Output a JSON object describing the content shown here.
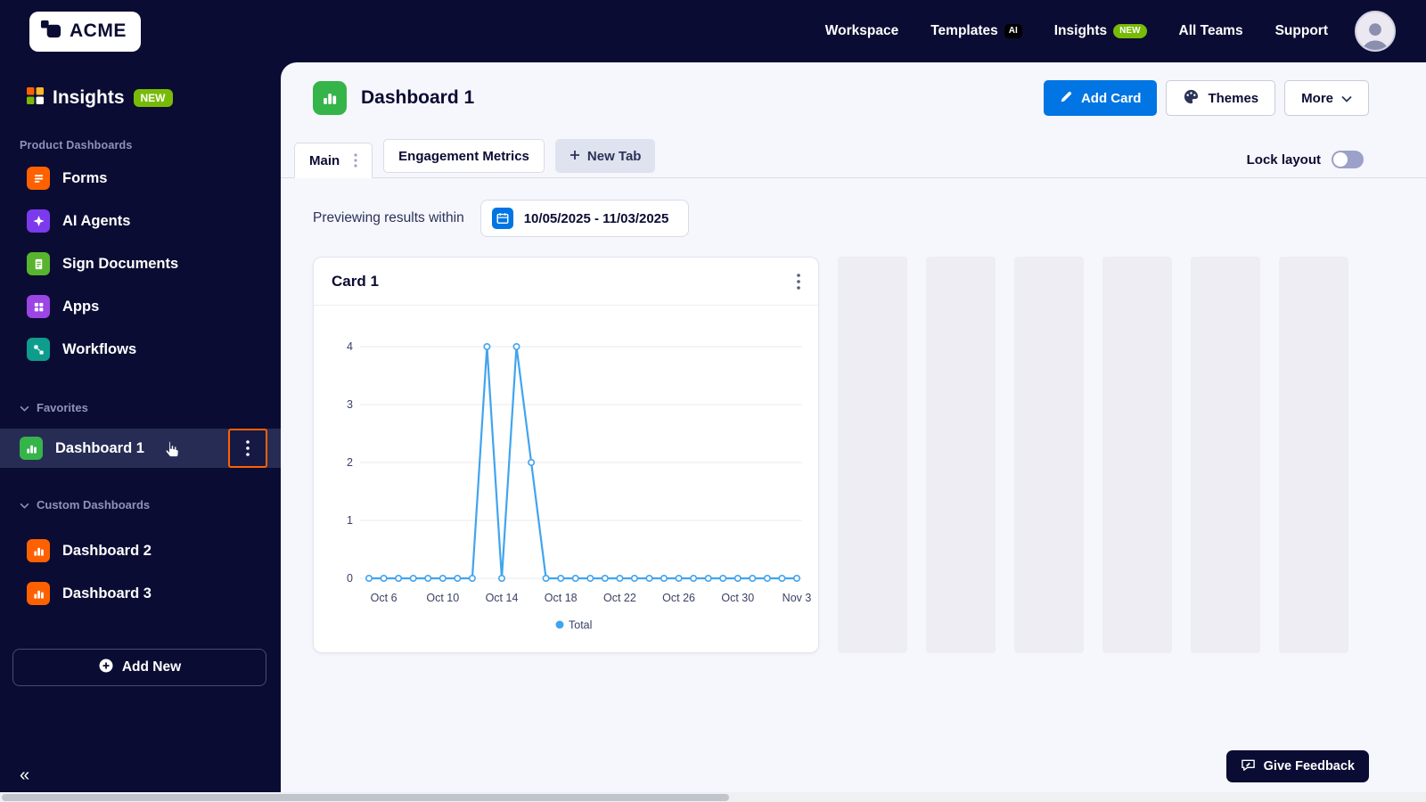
{
  "topbar": {
    "logo_text": "ACME",
    "nav": [
      {
        "label": "Workspace"
      },
      {
        "label": "Templates",
        "badge": "AI"
      },
      {
        "label": "Insights",
        "badge": "NEW"
      },
      {
        "label": "All Teams"
      },
      {
        "label": "Support"
      }
    ]
  },
  "sidebar": {
    "app_title": "Insights",
    "app_badge": "NEW",
    "product_section_label": "Product Dashboards",
    "product_items": [
      {
        "label": "Forms",
        "color": "#ff6100"
      },
      {
        "label": "AI Agents",
        "color": "#7c3aed"
      },
      {
        "label": "Sign Documents",
        "color": "#58b42e"
      },
      {
        "label": "Apps",
        "color": "#9b45e4"
      },
      {
        "label": "Workflows",
        "color": "#0e9c8d"
      }
    ],
    "favorites_label": "Favorites",
    "favorites_items": [
      {
        "label": "Dashboard 1",
        "selected": true,
        "color": "#35b44a"
      }
    ],
    "custom_section_label": "Custom Dashboards",
    "custom_items": [
      {
        "label": "Dashboard 2",
        "color": "#ff6100"
      },
      {
        "label": "Dashboard 3",
        "color": "#ff6100"
      }
    ],
    "add_new_label": "Add New",
    "collapse_glyph": "«"
  },
  "main": {
    "dashboard_title": "Dashboard 1",
    "add_card_label": "Add Card",
    "themes_label": "Themes",
    "more_label": "More",
    "tabs": [
      {
        "label": "Main",
        "active": true
      },
      {
        "label": "Engagement Metrics",
        "active": false
      },
      {
        "label": "New Tab",
        "active": false
      }
    ],
    "lock_layout_label": "Lock layout",
    "preview_label": "Previewing results within",
    "date_range": "10/05/2025 - 11/03/2025",
    "card_title": "Card 1",
    "feedback_label": "Give Feedback"
  },
  "colors": {
    "navy": "#0b0c33",
    "accent_blue": "#0075e3",
    "chart_blue": "#41a4ee",
    "badge_green": "#78bb07",
    "orange": "#ff6100"
  },
  "chart_data": {
    "type": "line",
    "title": "Card 1",
    "x": [
      "Oct 5",
      "Oct 6",
      "Oct 7",
      "Oct 8",
      "Oct 9",
      "Oct 10",
      "Oct 11",
      "Oct 12",
      "Oct 13",
      "Oct 14",
      "Oct 15",
      "Oct 16",
      "Oct 17",
      "Oct 18",
      "Oct 19",
      "Oct 20",
      "Oct 21",
      "Oct 22",
      "Oct 23",
      "Oct 24",
      "Oct 25",
      "Oct 26",
      "Oct 27",
      "Oct 28",
      "Oct 29",
      "Oct 30",
      "Oct 31",
      "Nov 1",
      "Nov 2",
      "Nov 3"
    ],
    "series": [
      {
        "name": "Total",
        "color": "#41a4ee",
        "values": [
          0,
          0,
          0,
          0,
          0,
          0,
          0,
          0,
          4,
          0,
          4,
          2,
          0,
          0,
          0,
          0,
          0,
          0,
          0,
          0,
          0,
          0,
          0,
          0,
          0,
          0,
          0,
          0,
          0,
          0
        ]
      }
    ],
    "x_tick_indices": [
      1,
      5,
      9,
      13,
      17,
      21,
      25,
      29
    ],
    "x_tick_labels": [
      "Oct 6",
      "Oct 10",
      "Oct 14",
      "Oct 18",
      "Oct 22",
      "Oct 26",
      "Oct 30",
      "Nov 3"
    ],
    "yticks": [
      0,
      1,
      2,
      3,
      4
    ],
    "ylim": [
      0,
      4
    ],
    "grid": "horizontal",
    "legend_position": "bottom"
  }
}
